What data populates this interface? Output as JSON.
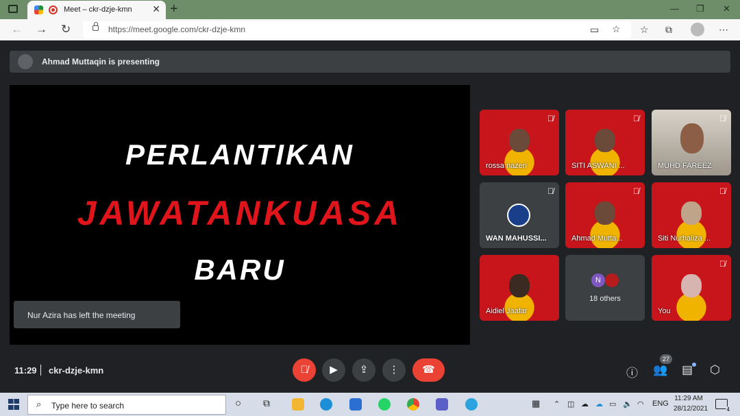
{
  "browser": {
    "tab_title": "Meet – ckr-dzje-kmn",
    "url": "https://meet.google.com/ckr-dzje-kmn"
  },
  "meet": {
    "presenting_text": "Ahmad Muttaqin is presenting",
    "slide_lines": [
      "PERLANTIKAN",
      "JAWATANKUASA",
      "BARU"
    ],
    "toast": "Nur Azira has left the meeting",
    "participants": [
      {
        "name": "rossa nazeri"
      },
      {
        "name": "SITI ASWANI ..."
      },
      {
        "name": "MUHD FAREEZ"
      },
      {
        "name": "WAN MAHUSSI..."
      },
      {
        "name": "Ahmad Mutta..."
      },
      {
        "name": "Siti Nurhaliza ..."
      },
      {
        "name": "Aidiel Jaafar"
      },
      {
        "name": "18 others",
        "initial": "N"
      },
      {
        "name": "You"
      }
    ],
    "time": "11:29",
    "meeting_code": "ckr-dzje-kmn",
    "participant_count": "27"
  },
  "taskbar": {
    "search_placeholder": "Type here to search",
    "language": "ENG",
    "clock_time": "11:29 AM",
    "clock_date": "28/12/2021",
    "notification_count": "4"
  },
  "colors": {
    "meet_bg": "#202124",
    "end_call": "#ea4335",
    "mic_off": "#ea4335",
    "tab_bar": "#6e8e6a"
  }
}
